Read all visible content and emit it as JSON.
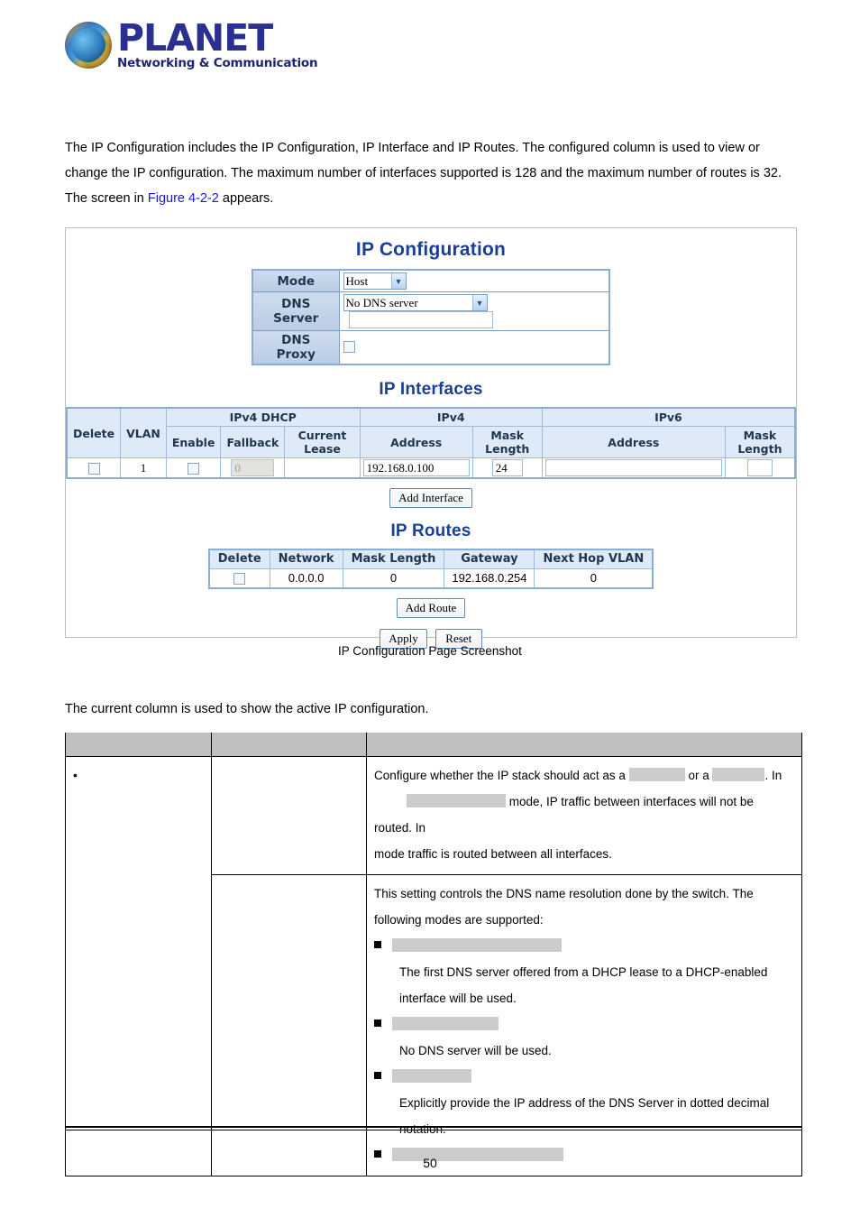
{
  "brand": {
    "name": "PLANET",
    "tagline": "Networking & Communication",
    "logo_icon": "planet-globe-logo"
  },
  "intro": {
    "line1": "The IP Configuration includes the IP Configuration, IP Interface and IP Routes. The configured column is used to view or",
    "line2": "change the IP configuration. The maximum number of interfaces supported is 128 and the maximum number of routes is 32.",
    "line3_pre": "The screen in ",
    "line3_link": "Figure 4-2-2",
    "line3_post": " appears.",
    "link_color": "#1a18e0"
  },
  "screenshot": {
    "ip_configuration": {
      "title": "IP Configuration",
      "rows": {
        "mode_label": "Mode",
        "mode_value": "Host",
        "dns_server_label": "DNS Server",
        "dns_server_value": "No DNS server",
        "dns_server_extra_value": "",
        "dns_proxy_label": "DNS Proxy",
        "dns_proxy_checked": false
      }
    },
    "ip_interfaces": {
      "title": "IP Interfaces",
      "group_headers": {
        "delete": "Delete",
        "vlan": "VLAN",
        "ipv4_dhcp": "IPv4 DHCP",
        "ipv4": "IPv4",
        "ipv6": "IPv6"
      },
      "sub_headers": {
        "enable": "Enable",
        "fallback": "Fallback",
        "current_lease": "Current Lease",
        "ipv4_address": "Address",
        "ipv4_mask_length": "Mask Length",
        "ipv6_address": "Address",
        "ipv6_mask_length": "Mask Length"
      },
      "rows": [
        {
          "delete_checked": false,
          "vlan": "1",
          "dhcp_enable_checked": false,
          "fallback": "0",
          "fallback_disabled": true,
          "current_lease": "",
          "ipv4_address": "192.168.0.100",
          "ipv4_mask_length": "24",
          "ipv6_address": "",
          "ipv6_mask_length": ""
        }
      ],
      "add_interface_button": "Add Interface"
    },
    "ip_routes": {
      "title": "IP Routes",
      "headers": [
        "Delete",
        "Network",
        "Mask Length",
        "Gateway",
        "Next Hop VLAN"
      ],
      "rows": [
        {
          "delete_checked": false,
          "network": "0.0.0.0",
          "mask_length": "0",
          "gateway": "192.168.0.254",
          "next_hop_vlan": "0"
        }
      ],
      "add_route_button": "Add Route"
    },
    "actions": {
      "apply": "Apply",
      "reset": "Reset"
    }
  },
  "caption": "IP Configuration Page Screenshot",
  "current_column_note": "The current column is used to show the active IP configuration.",
  "description_table": {
    "header": [
      "",
      "",
      ""
    ],
    "rows": [
      {
        "bullet": "•",
        "object": "",
        "object_redacted_width": 0,
        "description_lines": [
          {
            "type": "text",
            "pre": "Configure whether the IP stack should act as a",
            "redact1": 52,
            "mid": "or a",
            "redact2": 50,
            "post": ". In"
          },
          {
            "type": "indent",
            "redact": 110,
            "text": "mode, IP traffic between interfaces will not be routed. In"
          },
          {
            "type": "text_plain",
            "text": "mode traffic is routed between all interfaces."
          }
        ]
      },
      {
        "bullet": "",
        "object": "",
        "description_lines": [
          {
            "type": "text_plain",
            "text": "This setting controls the DNS name resolution done by the switch. The"
          },
          {
            "type": "text_plain",
            "text": "following modes are supported:"
          },
          {
            "type": "square_redact",
            "redact": 188
          },
          {
            "type": "sub_text",
            "text": "The first DNS server offered from a DHCP lease to a DHCP-enabled"
          },
          {
            "type": "sub_text",
            "text": "interface will be used."
          },
          {
            "type": "square_redact",
            "redact": 118
          },
          {
            "type": "sub_text",
            "text": "No DNS server will be used."
          },
          {
            "type": "square_redact",
            "redact": 88
          },
          {
            "type": "sub_text",
            "text": "Explicitly provide the IP address of the DNS Server in dotted decimal"
          },
          {
            "type": "sub_text",
            "text": "notation."
          },
          {
            "type": "square_redact",
            "redact": 190
          }
        ]
      }
    ]
  },
  "footer": {
    "page_number": "50"
  },
  "colors": {
    "title_blue": "#1b3f94",
    "table_header_blue": "#deeaf7",
    "mode_header_blue": "#c3d4e9",
    "redaction_gray": "#cccccc",
    "desc_header_gray": "#bfbfbf"
  }
}
